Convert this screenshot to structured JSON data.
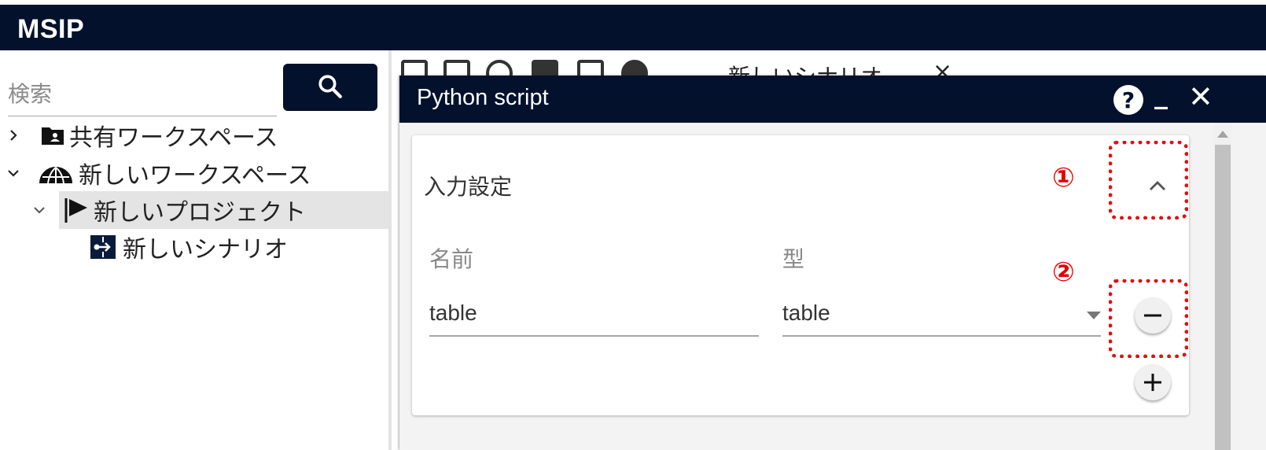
{
  "app": {
    "title": "MSIP"
  },
  "sidebar": {
    "search": {
      "placeholder": "検索"
    },
    "tree": [
      {
        "label": "共有ワークスペース",
        "icon": "shared-folder-icon",
        "expanded": false
      },
      {
        "label": "新しいワークスペース",
        "icon": "globe-workspace-icon",
        "expanded": true
      },
      {
        "label": "新しいプロジェクト",
        "icon": "flag-icon",
        "expanded": true,
        "selected": true
      },
      {
        "label": "新しいシナリオ",
        "icon": "scenario-icon"
      }
    ]
  },
  "toolbar": {
    "tab_label": "新しいシナリオ",
    "tab_close": "×"
  },
  "dialog": {
    "title": "Python script",
    "help": "?",
    "minimize": "_",
    "close": "✕",
    "panel": {
      "title": "入力設定",
      "name_label": "名前",
      "type_label": "型",
      "name_value": "table",
      "type_value": "table"
    }
  },
  "annotations": [
    {
      "number": "①"
    },
    {
      "number": "②"
    }
  ],
  "colors": {
    "header_bg": "#04112d",
    "annotation": "#e01010",
    "selected_row": "#e4e4e4"
  }
}
